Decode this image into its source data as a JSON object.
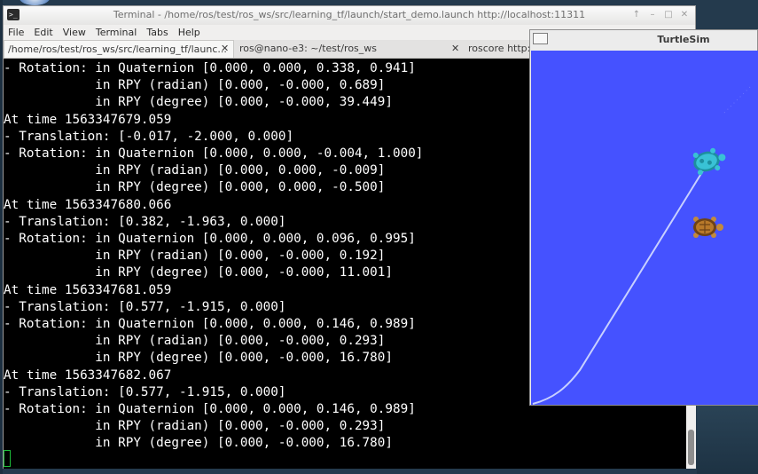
{
  "terminal": {
    "title": "Terminal - /home/ros/test/ros_ws/src/learning_tf/launch/start_demo.launch http://localhost:11311",
    "icon": "terminal-icon",
    "window_buttons": [
      "↑",
      "–",
      "□",
      "✕"
    ],
    "menu": [
      "File",
      "Edit",
      "View",
      "Terminal",
      "Tabs",
      "Help"
    ],
    "tabs": [
      {
        "label": "/home/ros/test/ros_ws/src/learning_tf/launc...",
        "close": "✕"
      },
      {
        "label": "ros@nano-e3: ~/test/ros_ws",
        "close": "✕"
      },
      {
        "label": "roscore http://"
      }
    ],
    "lines": [
      "- Rotation: in Quaternion [0.000, 0.000, 0.338, 0.941]",
      "            in RPY (radian) [0.000, -0.000, 0.689]",
      "            in RPY (degree) [0.000, -0.000, 39.449]",
      "At time 1563347679.059",
      "- Translation: [-0.017, -2.000, 0.000]",
      "- Rotation: in Quaternion [0.000, 0.000, -0.004, 1.000]",
      "            in RPY (radian) [0.000, 0.000, -0.009]",
      "            in RPY (degree) [0.000, 0.000, -0.500]",
      "At time 1563347680.066",
      "- Translation: [0.382, -1.963, 0.000]",
      "- Rotation: in Quaternion [0.000, 0.000, 0.096, 0.995]",
      "            in RPY (radian) [0.000, -0.000, 0.192]",
      "            in RPY (degree) [0.000, -0.000, 11.001]",
      "At time 1563347681.059",
      "- Translation: [0.577, -1.915, 0.000]",
      "- Rotation: in Quaternion [0.000, 0.000, 0.146, 0.989]",
      "            in RPY (radian) [0.000, -0.000, 0.293]",
      "            in RPY (degree) [0.000, -0.000, 16.780]",
      "At time 1563347682.067",
      "- Translation: [0.577, -1.915, 0.000]",
      "- Rotation: in Quaternion [0.000, 0.000, 0.146, 0.989]",
      "            in RPY (radian) [0.000, -0.000, 0.293]",
      "            in RPY (degree) [0.000, -0.000, 16.780]"
    ]
  },
  "turtlesim": {
    "title": "TurtleSim",
    "background_color": "#4552ff",
    "turtles": [
      {
        "name": "turtle-teal",
        "color": "#2fb6c9"
      },
      {
        "name": "turtle-brown",
        "color": "#b9772c"
      }
    ]
  }
}
